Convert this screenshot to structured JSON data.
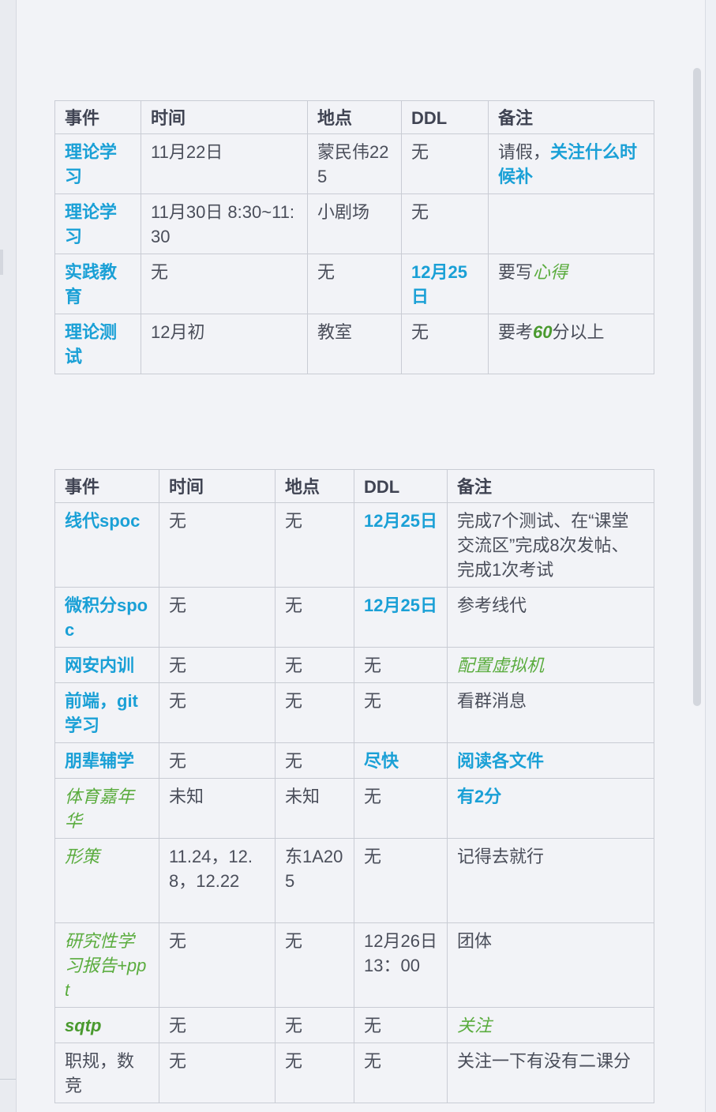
{
  "table1": {
    "headers": [
      "事件",
      "时间",
      "地点",
      "DDL",
      "备注"
    ],
    "rows": [
      {
        "event": "理论学习",
        "time": "11月22日",
        "place": "蒙民伟225",
        "ddl": "无",
        "note_a": "请假，",
        "note_b": "关注什么时候补"
      },
      {
        "event": "理论学习",
        "time": "11月30日 8:30~11:30",
        "place": "小剧场",
        "ddl": "无",
        "note_a": "",
        "note_b": ""
      },
      {
        "event": "实践教育",
        "time": "无",
        "place": "无",
        "ddl": "12月25日",
        "note_a": "要写",
        "note_b": "心得"
      },
      {
        "event": "理论测试",
        "time": "12月初",
        "place": "教室",
        "ddl": "无",
        "note_a": "要考",
        "note_b": "60",
        "note_c": "分以上"
      }
    ]
  },
  "table2": {
    "headers": [
      "事件",
      "时间",
      "地点",
      "DDL",
      "备注"
    ],
    "rows": [
      {
        "event": "线代spoc",
        "time": "无",
        "place": "无",
        "ddl": "12月25日",
        "note": "完成7个测试、在“课堂交流区”完成8次发帖、 完成1次考试"
      },
      {
        "event": "微积分spoc",
        "time": "无",
        "place": "无",
        "ddl": "12月25日",
        "note": "参考线代"
      },
      {
        "event": "网安内训",
        "time": "无",
        "place": "无",
        "ddl": "无",
        "note": "配置虚拟机"
      },
      {
        "event": "前端，git学习",
        "time": "无",
        "place": "无",
        "ddl": "无",
        "note": "看群消息"
      },
      {
        "event": "朋辈辅学",
        "time": "无",
        "place": "无",
        "ddl": "尽快",
        "note": "阅读各文件"
      },
      {
        "event": "体育嘉年华",
        "time": "未知",
        "place": "未知",
        "ddl": "无",
        "note": "有2分"
      },
      {
        "event": "形策",
        "time": "11.24，12.8，12.22",
        "place": "东1A205",
        "ddl": "无",
        "note": "记得去就行"
      },
      {
        "event": "研究性学习报告+ppt",
        "time": "无",
        "place": "无",
        "ddl": "12月26日13：00",
        "note": "团体"
      },
      {
        "event": "sqtp",
        "time": "无",
        "place": "无",
        "ddl": "无",
        "note": "关注"
      },
      {
        "event": "职规，数竞",
        "time": "无",
        "place": "无",
        "ddl": "无",
        "note": "关注一下有没有二课分"
      }
    ]
  },
  "colors": {
    "accent_blue": "#1aa0d6",
    "accent_green": "#5aac3e",
    "text": "#4a4e5a",
    "border": "#c9ccd4"
  }
}
